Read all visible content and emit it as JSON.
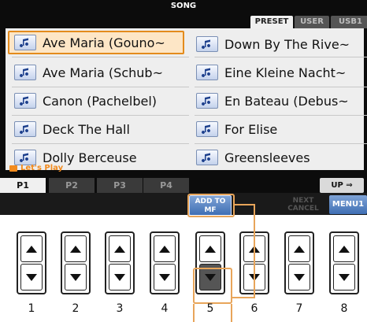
{
  "screen": {
    "title": "SONG",
    "tabs": [
      "PRESET",
      "USER",
      "USB1"
    ],
    "folder_label": "Let's Play",
    "songs_left": [
      "Ave Maria (Gouno~",
      "Ave Maria (Schub~",
      "Canon (Pachelbel)",
      "Deck The Hall",
      "Dolly Berceuse"
    ],
    "songs_right": [
      "Down By The Rive~",
      "Eine Kleine Nacht~",
      "En Bateau (Debus~",
      "For Elise",
      "Greensleeves"
    ],
    "page_tabs": [
      "P1",
      "P2",
      "P3",
      "P4"
    ],
    "up_label": "UP ⇒",
    "add_to_mf_line1": "ADD TO",
    "add_to_mf_line2": "MF",
    "next_label": "NEXT",
    "cancel_label": "CANCEL",
    "menu_label": "MENU1"
  },
  "buttons": {
    "numbers": [
      "1",
      "2",
      "3",
      "4",
      "5",
      "6",
      "7",
      "8"
    ]
  },
  "colors": {
    "accent": "#e48b1c",
    "highlight": "#e8a55a",
    "button_blue": "#3f6fb4"
  },
  "selected_song": "Ave Maria (Gouno~",
  "icons": [
    "music-note-icon",
    "folder-icon",
    "up-arrow-icon",
    "down-arrow-icon"
  ]
}
